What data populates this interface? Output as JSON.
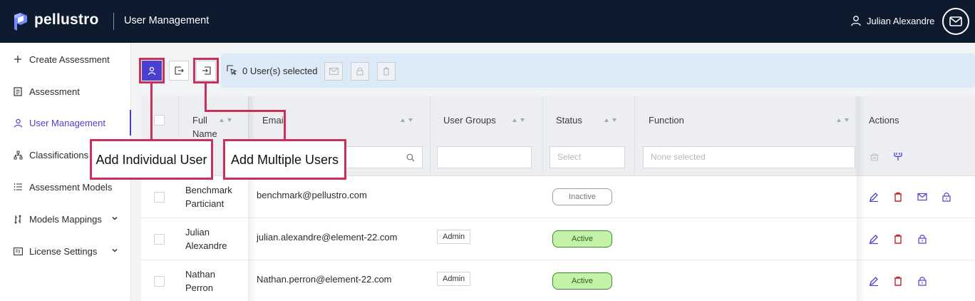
{
  "header": {
    "brand": "pellustro",
    "page_title": "User Management",
    "user_name": "Julian Alexandre",
    "bg_color": "#0e1a2e"
  },
  "sidebar": {
    "items": [
      {
        "label": "Create Assessment",
        "icon": "plus-icon"
      },
      {
        "label": "Assessment",
        "icon": "clipboard-icon"
      },
      {
        "label": "User Management",
        "icon": "user-icon",
        "active": true
      },
      {
        "label": "Classifications",
        "icon": "hierarchy-icon"
      },
      {
        "label": "Assessment Models",
        "icon": "list-icon"
      },
      {
        "label": "Models Mappings",
        "icon": "mapping-icon",
        "expandable": true
      },
      {
        "label": "License Settings",
        "icon": "license-icon",
        "expandable": true
      }
    ],
    "accent_color": "#4a3fd1"
  },
  "toolbar": {
    "selected_text": "0 User(s) selected"
  },
  "table": {
    "columns": [
      {
        "label": "Full Name"
      },
      {
        "label": "Email"
      },
      {
        "label": "User Groups"
      },
      {
        "label": "Status"
      },
      {
        "label": "Function"
      },
      {
        "label": "Actions"
      }
    ],
    "filters": {
      "status_placeholder": "Select",
      "function_placeholder": "None selected"
    },
    "rows": [
      {
        "name_line1": "Benchmark",
        "name_line2": "Particiant",
        "email": "benchmark@pellustro.com",
        "group": "",
        "status": "Inactive"
      },
      {
        "name_line1": "Julian",
        "name_line2": "Alexandre",
        "email": "julian.alexandre@element-22.com",
        "group": "Admin",
        "status": "Active"
      },
      {
        "name_line1": "Nathan",
        "name_line2": "Perron",
        "email": "Nathan.perron@element-22.com",
        "group": "Admin",
        "status": "Active"
      }
    ]
  },
  "callouts": {
    "add_individual": "Add Individual User",
    "add_multiple": "Add Multiple Users",
    "color": "#c7315a"
  },
  "status_colors": {
    "active_bg": "#c4f2a8",
    "active_border": "#3a8a2e",
    "inactive_border": "#9c9c9c"
  }
}
